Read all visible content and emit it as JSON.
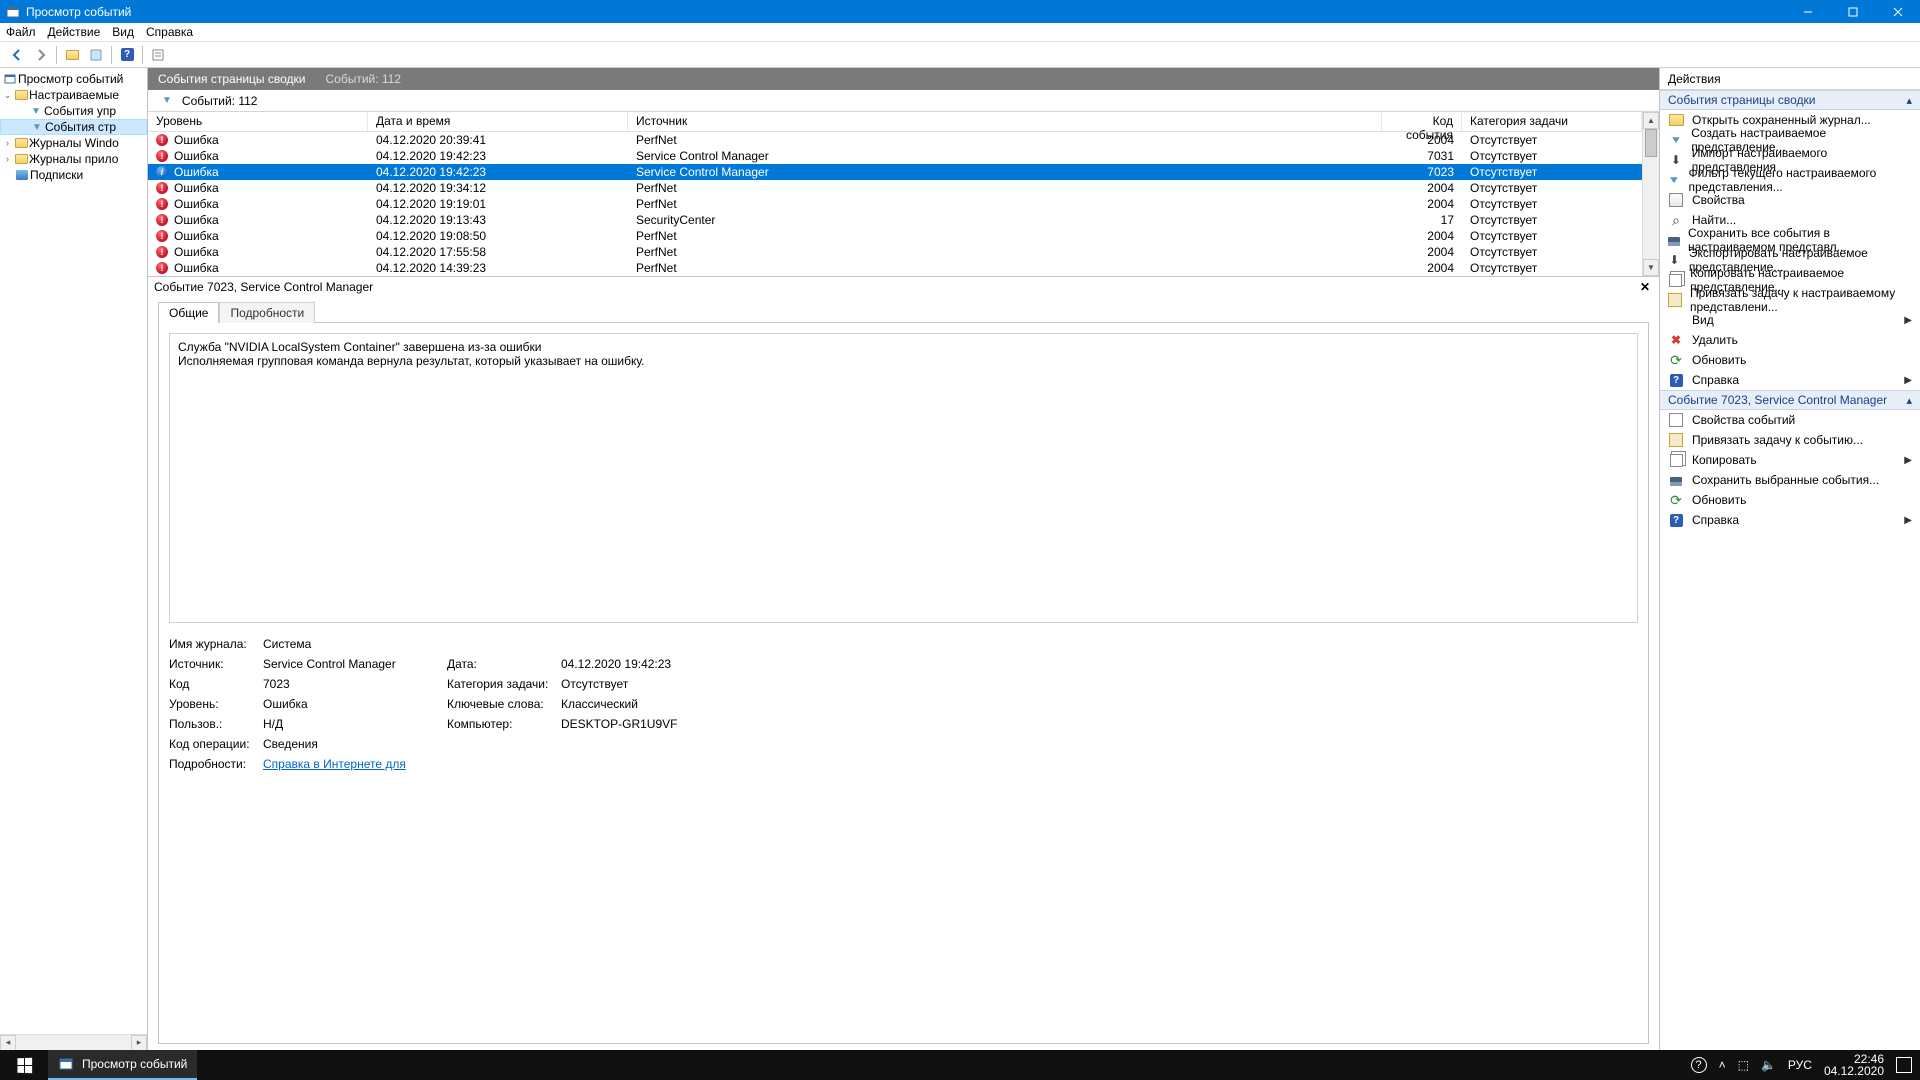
{
  "window": {
    "title": "Просмотр событий"
  },
  "menu": {
    "file": "Файл",
    "action": "Действие",
    "view": "Вид",
    "help": "Справка"
  },
  "tree": {
    "root": "Просмотр событий",
    "custom_views": "Настраиваемые",
    "admin_events": "События упр",
    "summary_page": "События стр",
    "windows_logs": "Журналы Windo",
    "app_logs": "Журналы прило",
    "subscriptions": "Подписки"
  },
  "center": {
    "header_title": "События страницы сводки",
    "header_count": "Событий: 112",
    "filter_count": "Событий: 112",
    "cols": {
      "level": "Уровень",
      "dt": "Дата и время",
      "src": "Источник",
      "code": "Код события",
      "cat": "Категория задачи"
    },
    "rows": [
      {
        "type": "err",
        "level": "Ошибка",
        "dt": "04.12.2020 20:39:41",
        "src": "PerfNet",
        "code": "2004",
        "cat": "Отсутствует"
      },
      {
        "type": "err",
        "level": "Ошибка",
        "dt": "04.12.2020 19:42:23",
        "src": "Service Control Manager",
        "code": "7031",
        "cat": "Отсутствует"
      },
      {
        "type": "info",
        "level": "Ошибка",
        "dt": "04.12.2020 19:42:23",
        "src": "Service Control Manager",
        "code": "7023",
        "cat": "Отсутствует",
        "sel": true
      },
      {
        "type": "err",
        "level": "Ошибка",
        "dt": "04.12.2020 19:34:12",
        "src": "PerfNet",
        "code": "2004",
        "cat": "Отсутствует"
      },
      {
        "type": "err",
        "level": "Ошибка",
        "dt": "04.12.2020 19:19:01",
        "src": "PerfNet",
        "code": "2004",
        "cat": "Отсутствует"
      },
      {
        "type": "err",
        "level": "Ошибка",
        "dt": "04.12.2020 19:13:43",
        "src": "SecurityCenter",
        "code": "17",
        "cat": "Отсутствует"
      },
      {
        "type": "err",
        "level": "Ошибка",
        "dt": "04.12.2020 19:08:50",
        "src": "PerfNet",
        "code": "2004",
        "cat": "Отсутствует"
      },
      {
        "type": "err",
        "level": "Ошибка",
        "dt": "04.12.2020 17:55:58",
        "src": "PerfNet",
        "code": "2004",
        "cat": "Отсутствует"
      },
      {
        "type": "err",
        "level": "Ошибка",
        "dt": "04.12.2020 14:39:23",
        "src": "PerfNet",
        "code": "2004",
        "cat": "Отсутствует"
      }
    ]
  },
  "detail": {
    "title": "Событие 7023, Service Control Manager",
    "tab_general": "Общие",
    "tab_details": "Подробности",
    "desc_l1": "Служба \"NVIDIA LocalSystem Container\" завершена из-за ошибки",
    "desc_l2": "Исполняемая групповая команда вернула результат, который указывает на ошибку.",
    "labels": {
      "logname": "Имя журнала:",
      "source": "Источник:",
      "date": "Дата:",
      "code": "Код",
      "category": "Категория задачи:",
      "level": "Уровень:",
      "keywords": "Ключевые слова:",
      "user": "Пользов.:",
      "computer": "Компьютер:",
      "opcode": "Код операции:",
      "more": "Подробности:"
    },
    "values": {
      "logname": "Система",
      "source": "Service Control Manager",
      "date": "04.12.2020 19:42:23",
      "code": "7023",
      "category": "Отсутствует",
      "level": "Ошибка",
      "keywords": "Классический",
      "user": "Н/Д",
      "computer": "DESKTOP-GR1U9VF",
      "opcode": "Сведения",
      "more_link": "Справка в Интернете для"
    }
  },
  "actions": {
    "header": "Действия",
    "group1_title": "События страницы сводки",
    "group1": [
      {
        "icon": "open",
        "label": "Открыть сохраненный журнал..."
      },
      {
        "icon": "filter",
        "label": "Создать настраиваемое представление..."
      },
      {
        "icon": "import",
        "label": "Импорт настраиваемого представления"
      },
      {
        "icon": "filter",
        "label": "Фильтр текущего настраиваемого представления..."
      },
      {
        "icon": "props",
        "label": "Свойства"
      },
      {
        "icon": "find",
        "label": "Найти..."
      },
      {
        "icon": "save",
        "label": "Сохранить все события в настраиваемом представл..."
      },
      {
        "icon": "import",
        "label": "Экспортировать настраиваемое представление..."
      },
      {
        "icon": "copy",
        "label": "Копировать настраиваемое представление..."
      },
      {
        "icon": "tasksq",
        "label": "Привязать задачу к настраиваемому представлени..."
      },
      {
        "icon": "",
        "label": "Вид",
        "submenu": true
      },
      {
        "icon": "delete",
        "label": "Удалить"
      },
      {
        "icon": "refresh",
        "label": "Обновить"
      },
      {
        "icon": "help",
        "label": "Справка",
        "submenu": true
      }
    ],
    "group2_title": "Событие 7023, Service Control Manager",
    "group2": [
      {
        "icon": "eventprops",
        "label": "Свойства событий"
      },
      {
        "icon": "tasksq",
        "label": "Привязать задачу к событию..."
      },
      {
        "icon": "copy",
        "label": "Копировать",
        "submenu": true
      },
      {
        "icon": "save",
        "label": "Сохранить выбранные события..."
      },
      {
        "icon": "refresh",
        "label": "Обновить"
      },
      {
        "icon": "help",
        "label": "Справка",
        "submenu": true
      }
    ]
  },
  "taskbar": {
    "active_app": "Просмотр событий",
    "lang": "РУС",
    "time": "22:46",
    "date": "04.12.2020"
  }
}
